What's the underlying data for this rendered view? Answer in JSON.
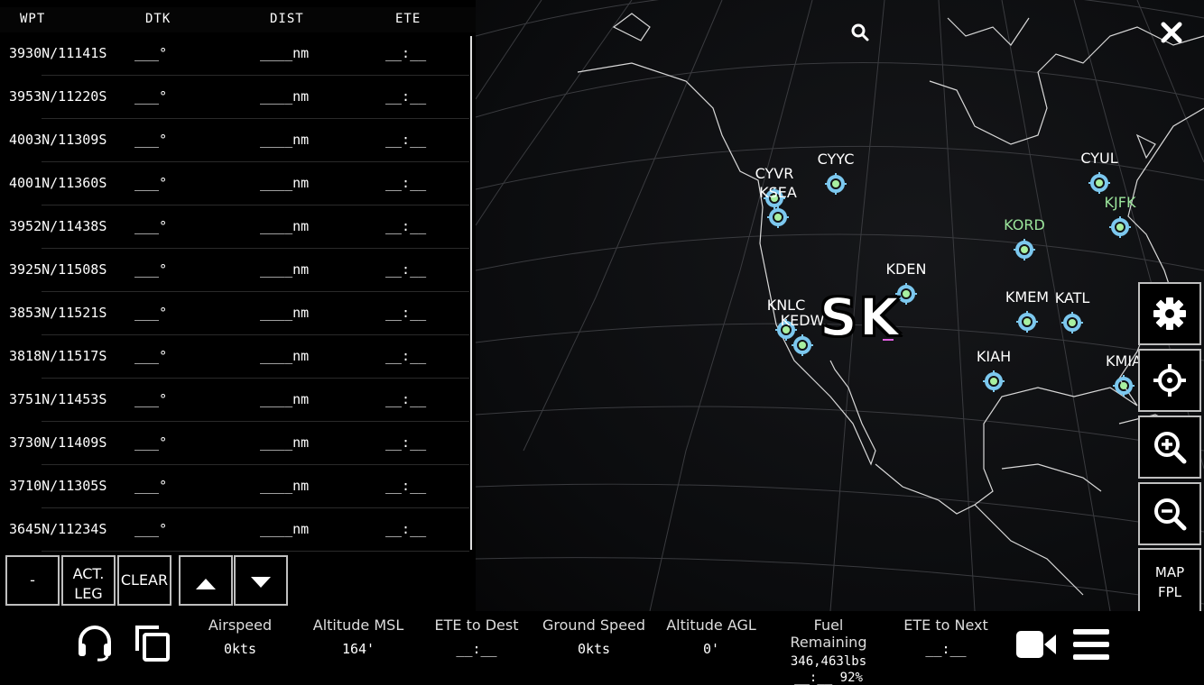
{
  "flight_plan": {
    "headers": {
      "wpt": "WPT",
      "dtk": "DTK",
      "dist": "DIST",
      "ete": "ETE"
    },
    "rows": [
      {
        "wpt": "3930N/11141S",
        "dtk": "___°",
        "dist": "____nm",
        "ete": "__:__"
      },
      {
        "wpt": "3953N/11220S",
        "dtk": "___°",
        "dist": "____nm",
        "ete": "__:__"
      },
      {
        "wpt": "4003N/11309S",
        "dtk": "___°",
        "dist": "____nm",
        "ete": "__:__"
      },
      {
        "wpt": "4001N/11360S",
        "dtk": "___°",
        "dist": "____nm",
        "ete": "__:__"
      },
      {
        "wpt": "3952N/11438S",
        "dtk": "___°",
        "dist": "____nm",
        "ete": "__:__"
      },
      {
        "wpt": "3925N/11508S",
        "dtk": "___°",
        "dist": "____nm",
        "ete": "__:__"
      },
      {
        "wpt": "3853N/11521S",
        "dtk": "___°",
        "dist": "____nm",
        "ete": "__:__"
      },
      {
        "wpt": "3818N/11517S",
        "dtk": "___°",
        "dist": "____nm",
        "ete": "__:__"
      },
      {
        "wpt": "3751N/11453S",
        "dtk": "___°",
        "dist": "____nm",
        "ete": "__:__"
      },
      {
        "wpt": "3730N/11409S",
        "dtk": "___°",
        "dist": "____nm",
        "ete": "__:__"
      },
      {
        "wpt": "3710N/11305S",
        "dtk": "___°",
        "dist": "____nm",
        "ete": "__:__"
      },
      {
        "wpt": "3645N/11234S",
        "dtk": "___°",
        "dist": "____nm",
        "ete": "__:__"
      }
    ]
  },
  "controls": {
    "minus_label": "-",
    "act_leg_line1": "ACT.",
    "act_leg_line2": "LEG",
    "clear_label": "CLEAR",
    "map_line1": "MAP",
    "map_line2": "FPL"
  },
  "map": {
    "center_label": "SK",
    "airports": [
      {
        "code": "CYVR",
        "color": "#ffffff"
      },
      {
        "code": "KSEA",
        "color": "#ffffff"
      },
      {
        "code": "CYYC",
        "color": "#ffffff"
      },
      {
        "code": "CYUL",
        "color": "#ffffff"
      },
      {
        "code": "KJFK",
        "color": "#9be59b"
      },
      {
        "code": "KORD",
        "color": "#9be59b"
      },
      {
        "code": "KDEN",
        "color": "#ffffff"
      },
      {
        "code": "KNLC",
        "color": "#ffffff"
      },
      {
        "code": "KEDW",
        "color": "#ffffff"
      },
      {
        "code": "KMEM",
        "color": "#ffffff"
      },
      {
        "code": "KATL",
        "color": "#ffffff"
      },
      {
        "code": "KIAH",
        "color": "#ffffff"
      },
      {
        "code": "KMIA",
        "color": "#ffffff"
      }
    ],
    "waypoint_ring_color": "#7cc8ef",
    "waypoint_core_color": "#a8f0a0"
  },
  "status": {
    "airspeed": {
      "label": "Airspeed",
      "value": "0kts"
    },
    "altitude_msl": {
      "label": "Altitude MSL",
      "value": "164'"
    },
    "ete_dest": {
      "label": "ETE to Dest",
      "value": "__:__"
    },
    "ground_speed": {
      "label": "Ground Speed",
      "value": "0kts"
    },
    "altitude_agl": {
      "label": "Altitude AGL",
      "value": "0'"
    },
    "fuel": {
      "label": "Fuel Remaining",
      "value": "346,463lbs",
      "value2": "__:__ 92%"
    },
    "ete_next": {
      "label": "ETE to Next",
      "value": "__:__"
    }
  },
  "icons": [
    "search-icon",
    "close-icon",
    "gear-icon",
    "crosshair-icon",
    "zoom-in-icon",
    "zoom-out-icon",
    "headset-icon",
    "copy-icon",
    "camera-icon",
    "menu-icon",
    "arrow-up-icon",
    "arrow-down-icon"
  ]
}
